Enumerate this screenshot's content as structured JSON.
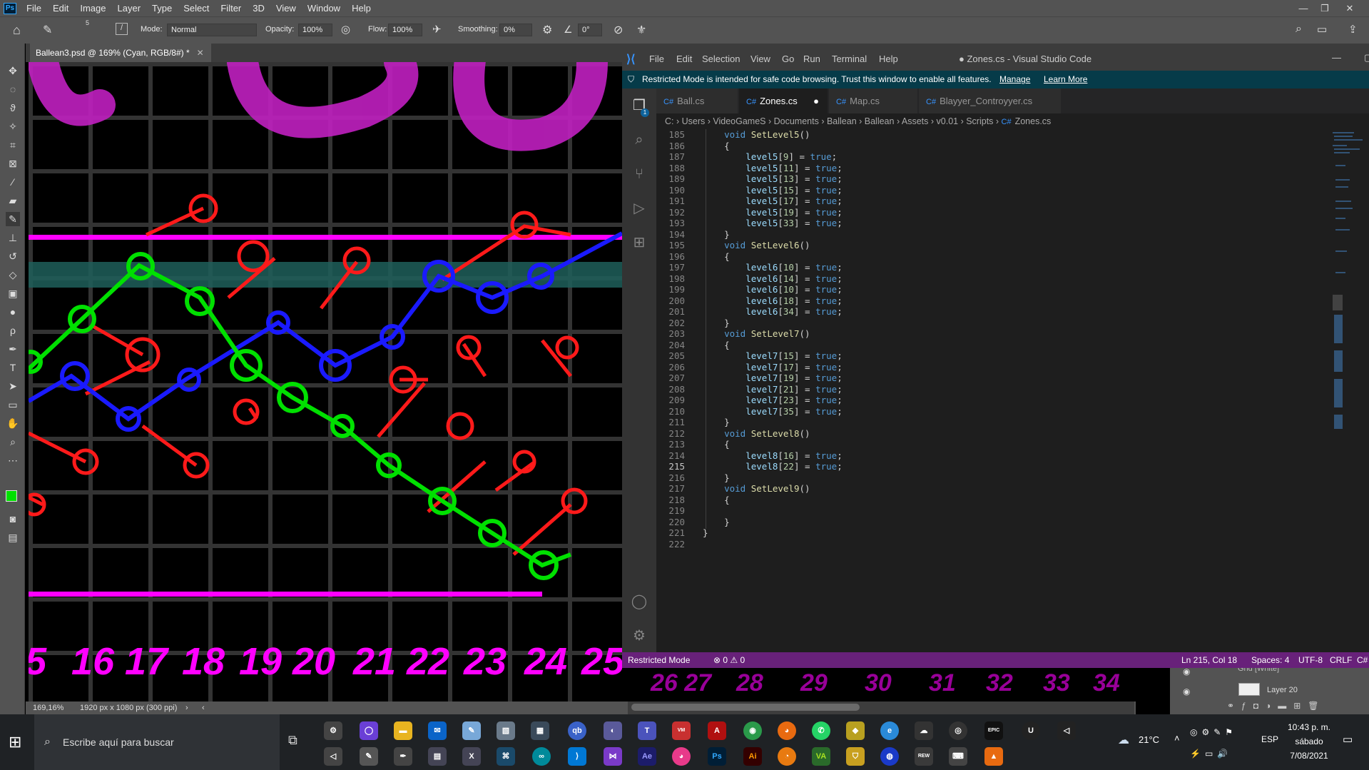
{
  "photoshop": {
    "menu": [
      "File",
      "Edit",
      "Image",
      "Layer",
      "Type",
      "Select",
      "Filter",
      "3D",
      "View",
      "Window",
      "Help"
    ],
    "options": {
      "brush_size": "5",
      "mode_label": "Mode:",
      "mode_value": "Normal",
      "opacity_label": "Opacity:",
      "opacity_value": "100%",
      "flow_label": "Flow:",
      "flow_value": "100%",
      "smoothing_label": "Smoothing:",
      "smoothing_value": "0%",
      "angle_value": "0°"
    },
    "document_tab": "Ballean3.psd @ 169% (Cyan, RGB/8#) *",
    "status_zoom": "169,16%",
    "status_doc": "1920 px x 1080 px (300 ppi)",
    "layers": {
      "layer1_name": "Grid [White]",
      "layer2_name": "Layer 20"
    },
    "canvas_numbers": [
      "5",
      "16",
      "17",
      "18",
      "19",
      "20",
      "21",
      "22",
      "23",
      "24",
      "25"
    ],
    "colors": {
      "magenta": "#ff00ff",
      "green": "#00e000",
      "blue": "#1a1aff",
      "red": "#ff1a1a",
      "teal": "#1f5f5a"
    }
  },
  "vscode": {
    "menu": [
      "File",
      "Edit",
      "Selection",
      "View",
      "Go",
      "Run",
      "Terminal",
      "Help"
    ],
    "window_title": "● Zones.cs - Visual Studio Code",
    "banner": {
      "text": "Restricted Mode is intended for safe code browsing. Trust this window to enable all features.",
      "manage": "Manage",
      "learn_more": "Learn More"
    },
    "tabs": [
      {
        "label": "Ball.cs",
        "active": false
      },
      {
        "label": "Zones.cs",
        "active": true,
        "modified": "●"
      },
      {
        "label": "Map.cs",
        "active": false
      },
      {
        "label": "Blayyer_Controyyer.cs",
        "active": false
      }
    ],
    "breadcrumb": [
      "C:",
      "Users",
      "VideoGameS",
      "Documents",
      "Ballean",
      "Ballean",
      "Assets",
      "v0.01",
      "Scripts",
      "Zones.cs"
    ],
    "lines": [
      {
        "n": "185",
        "t": "    void SetLevel5()"
      },
      {
        "n": "186",
        "t": "    {"
      },
      {
        "n": "187",
        "t": "        level5[9] = true;"
      },
      {
        "n": "188",
        "t": "        level5[11] = true;"
      },
      {
        "n": "189",
        "t": "        level5[13] = true;"
      },
      {
        "n": "190",
        "t": "        level5[15] = true;"
      },
      {
        "n": "191",
        "t": "        level5[17] = true;"
      },
      {
        "n": "192",
        "t": "        level5[19] = true;"
      },
      {
        "n": "193",
        "t": "        level5[33] = true;"
      },
      {
        "n": "194",
        "t": "    }"
      },
      {
        "n": "195",
        "t": "    void SetLevel6()"
      },
      {
        "n": "196",
        "t": "    {"
      },
      {
        "n": "197",
        "t": "        level6[10] = true;"
      },
      {
        "n": "198",
        "t": "        level6[14] = true;"
      },
      {
        "n": "199",
        "t": "        level6[10] = true;"
      },
      {
        "n": "200",
        "t": "        level6[18] = true;"
      },
      {
        "n": "201",
        "t": "        level6[34] = true;"
      },
      {
        "n": "202",
        "t": "    }"
      },
      {
        "n": "203",
        "t": "    void SetLevel7()"
      },
      {
        "n": "204",
        "t": "    {"
      },
      {
        "n": "205",
        "t": "        level7[15] = true;"
      },
      {
        "n": "206",
        "t": "        level7[17] = true;"
      },
      {
        "n": "207",
        "t": "        level7[19] = true;"
      },
      {
        "n": "208",
        "t": "        level7[21] = true;"
      },
      {
        "n": "209",
        "t": "        level7[23] = true;"
      },
      {
        "n": "210",
        "t": "        level7[35] = true;"
      },
      {
        "n": "211",
        "t": "    }"
      },
      {
        "n": "212",
        "t": "    void SetLevel8()"
      },
      {
        "n": "213",
        "t": "    {"
      },
      {
        "n": "214",
        "t": "        level8[16] = true;"
      },
      {
        "n": "215",
        "t": "        level8[22] = true;"
      },
      {
        "n": "216",
        "t": "    }"
      },
      {
        "n": "217",
        "t": "    void SetLevel9()"
      },
      {
        "n": "218",
        "t": "    {"
      },
      {
        "n": "219",
        "t": ""
      },
      {
        "n": "220",
        "t": "    }"
      },
      {
        "n": "221",
        "t": "}"
      },
      {
        "n": "222",
        "t": ""
      }
    ],
    "current_line": "215",
    "status": {
      "restricted": "Restricted Mode",
      "problems": "⊗ 0 ⚠ 0",
      "position": "Ln 215, Col 18",
      "spaces": "Spaces: 4",
      "encoding": "UTF-8",
      "eol": "CRLF",
      "language": "C#"
    }
  },
  "taskbar": {
    "search_placeholder": "Escribe aquí para buscar",
    "weather": "21°C",
    "lang": "ESP",
    "time": "10:43 p. m.",
    "day": "sábado",
    "date": "7/08/2021"
  }
}
